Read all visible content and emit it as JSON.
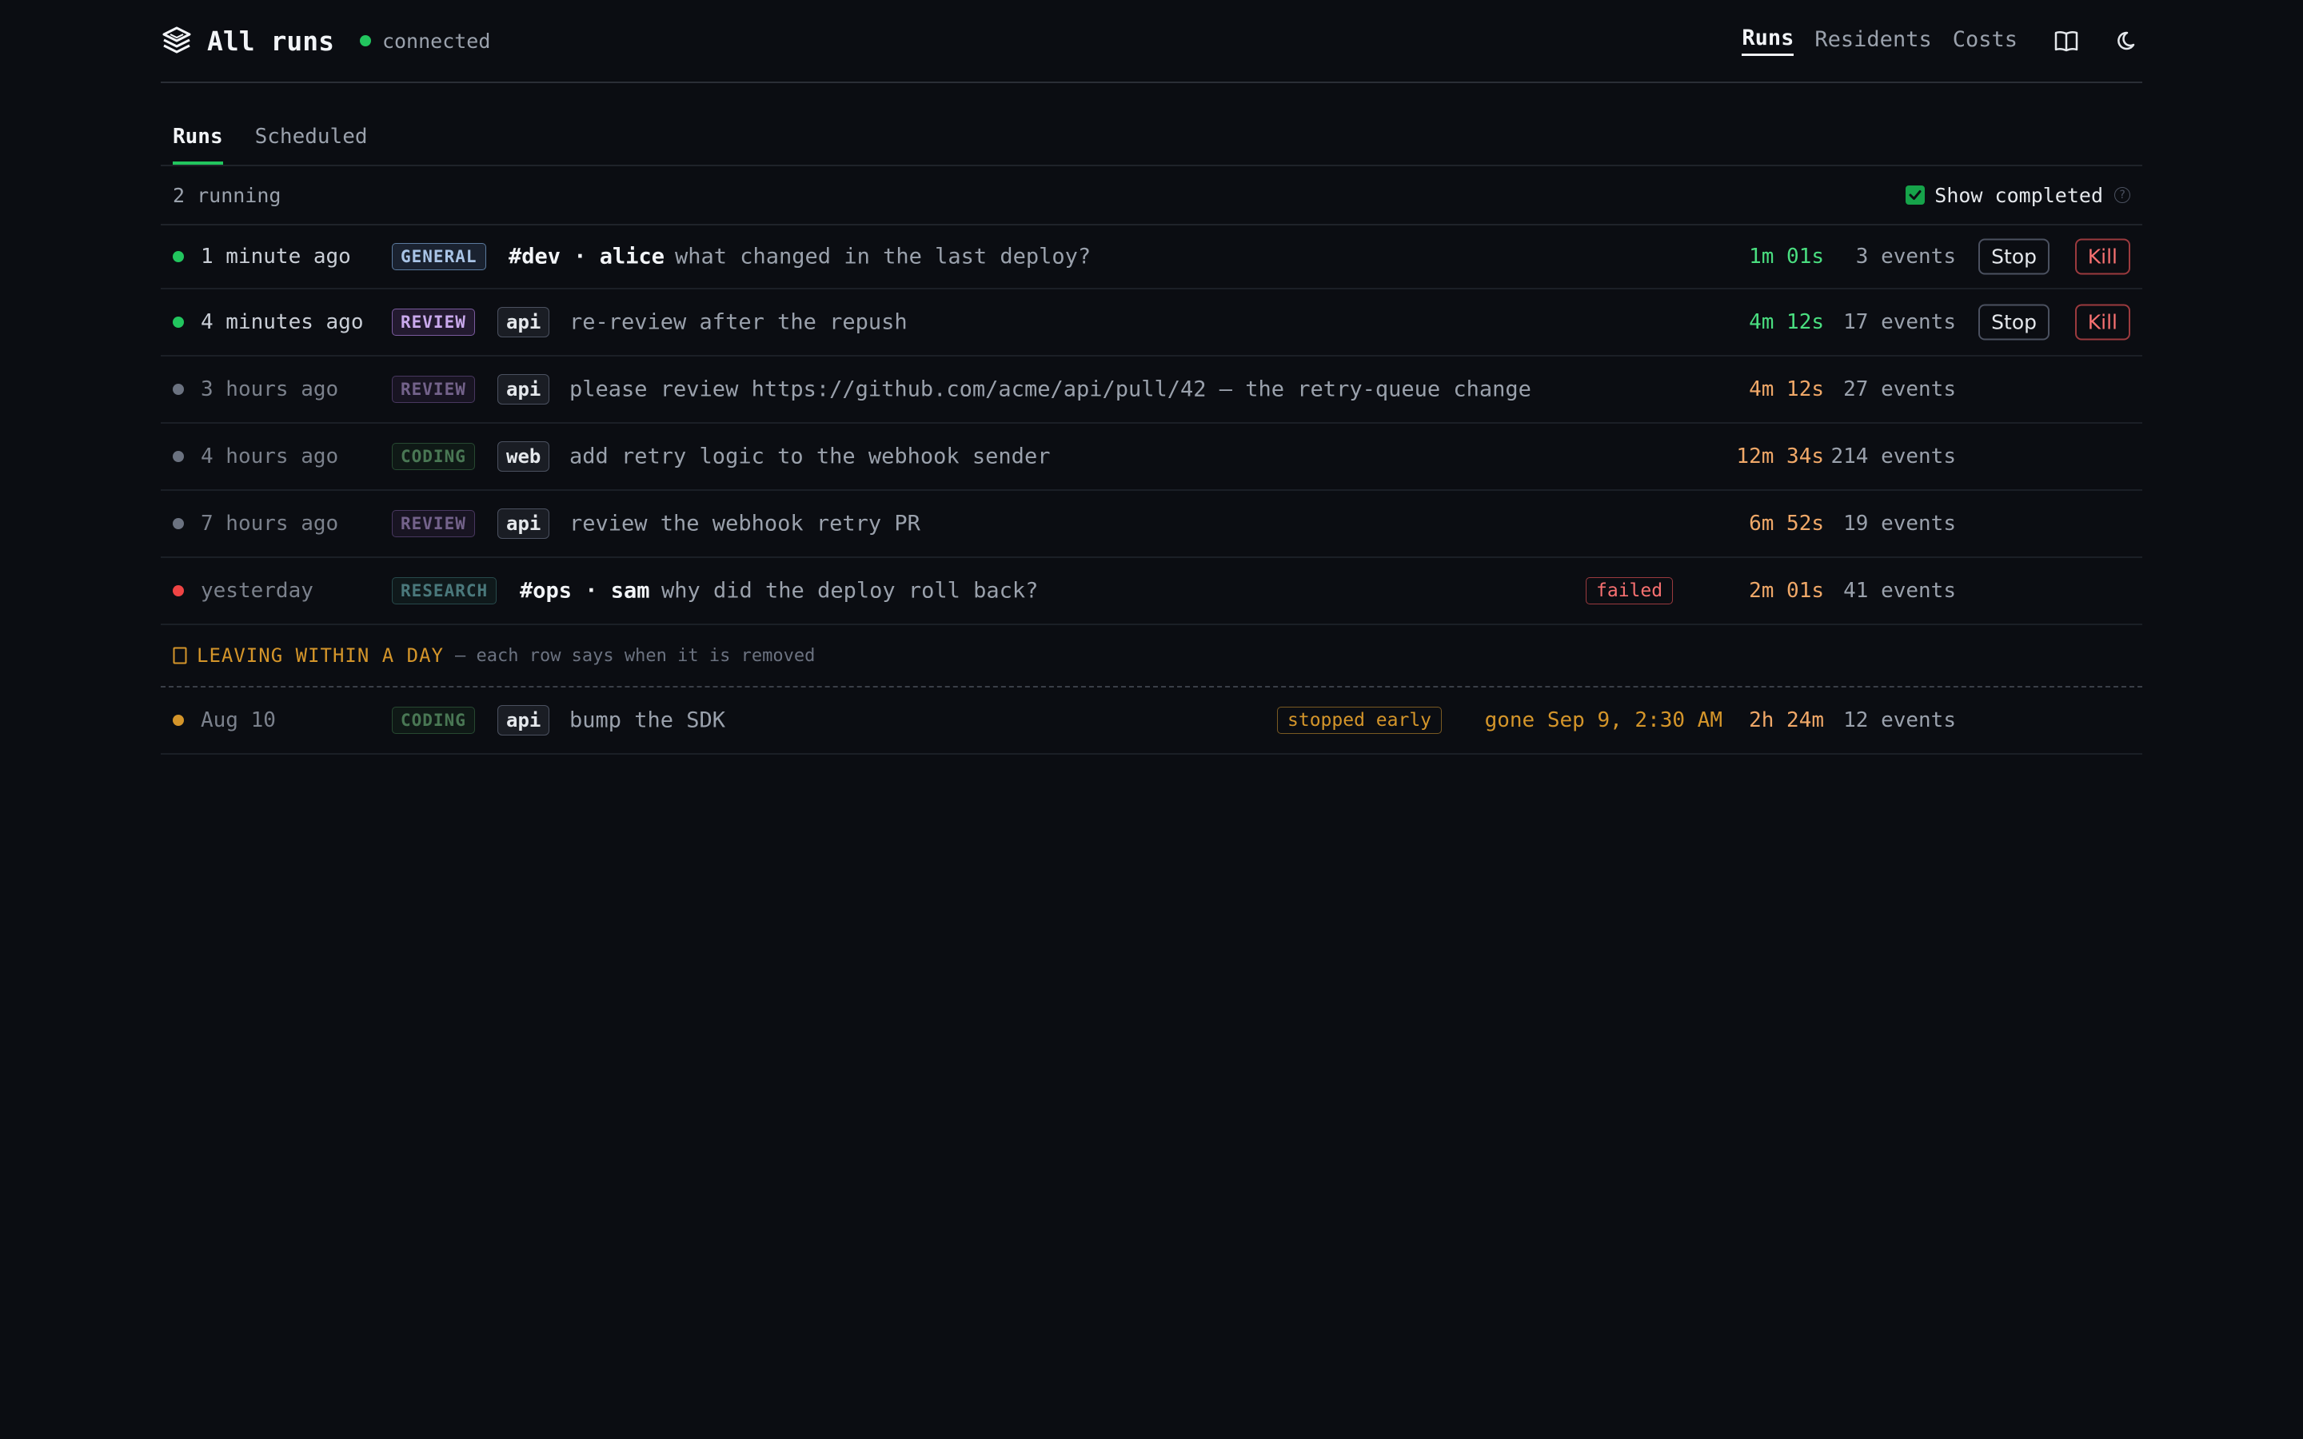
{
  "header": {
    "title": "All runs",
    "connection_status": "connected",
    "nav": [
      "Runs",
      "Residents",
      "Costs"
    ],
    "icons": [
      "stack-logo-icon",
      "book-icon",
      "moon-icon"
    ]
  },
  "tabs": [
    "Runs",
    "Scheduled"
  ],
  "toolbar": {
    "running_count": "2 running",
    "show_completed_label": "Show completed",
    "show_completed_checked": true,
    "help": "?"
  },
  "runs": [
    {
      "when": "1 minute ago",
      "kind": "GENERAL",
      "channel": "#dev · alice",
      "prompt": "what changed in the last deploy?",
      "duration": "1m 01s",
      "events": "3 events",
      "actions": [
        "Stop",
        "Kill"
      ],
      "status": "running"
    },
    {
      "when": "4 minutes ago",
      "kind": "REVIEW",
      "repo": "api",
      "prompt": "re-review after the repush",
      "duration": "4m 12s",
      "events": "17 events",
      "actions": [
        "Stop",
        "Kill"
      ],
      "status": "running"
    },
    {
      "when": "3 hours ago",
      "kind": "REVIEW",
      "repo": "api",
      "prompt": "please review https://github.com/acme/api/pull/42 — the retry-queue change",
      "duration": "4m 12s",
      "events": "27 events",
      "status": "completed"
    },
    {
      "when": "4 hours ago",
      "kind": "CODING",
      "repo": "web",
      "prompt": "add retry logic to the webhook sender",
      "duration": "12m 34s",
      "events": "214 events",
      "status": "completed"
    },
    {
      "when": "7 hours ago",
      "kind": "REVIEW",
      "repo": "api",
      "prompt": "review the webhook retry PR",
      "duration": "6m 52s",
      "events": "19 events",
      "status": "completed"
    },
    {
      "when": "yesterday",
      "kind": "RESEARCH",
      "channel": "#ops · sam",
      "prompt": "why did the deploy roll back?",
      "badge": "failed",
      "duration": "2m 01s",
      "events": "41 events",
      "status": "failed"
    }
  ],
  "leaving": {
    "title": "LEAVING WITHIN A DAY",
    "subtitle": "— each row says when it is removed",
    "icon": "hourglass-icon",
    "rows": [
      {
        "when": "Aug 10",
        "kind": "CODING",
        "repo": "api",
        "prompt": "bump the SDK",
        "badge": "stopped early",
        "gone": "gone Sep 9, 2:30 AM",
        "duration": "2h 24m",
        "events": "12 events",
        "status": "stopped"
      }
    ]
  },
  "colors": {
    "background": "#0b0d12",
    "running_dot": "#22c55e",
    "completed_dot": "#6b7280",
    "failed_dot": "#ef4444",
    "stopped_dot": "#d4952a",
    "accent_green": "#22c55e"
  }
}
